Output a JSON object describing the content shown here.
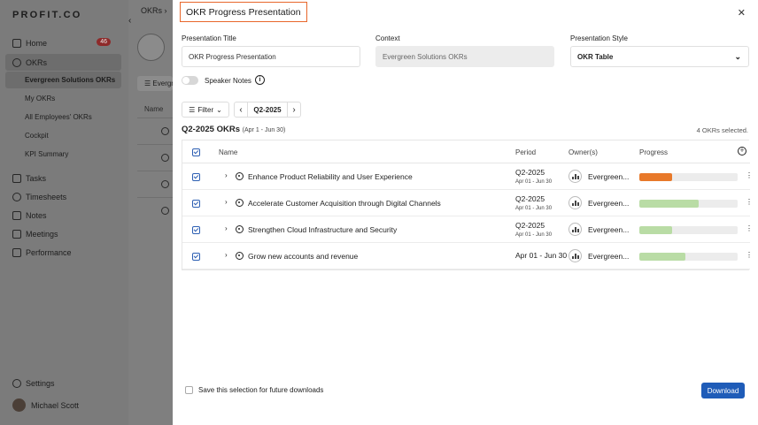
{
  "app": {
    "logo": "PROFIT.CO"
  },
  "sidebar": {
    "items": [
      {
        "label": "Home",
        "icon": "home-icon",
        "badge": "46"
      },
      {
        "label": "OKRs",
        "icon": "okr-icon"
      },
      {
        "label": "Evergreen Solutions OKRs"
      },
      {
        "label": "My OKRs"
      },
      {
        "label": "All Employees' OKRs"
      },
      {
        "label": "Cockpit"
      },
      {
        "label": "KPI Summary"
      },
      {
        "label": "Tasks",
        "icon": "tasks-icon"
      },
      {
        "label": "Timesheets",
        "icon": "timesheets-icon"
      },
      {
        "label": "Notes",
        "icon": "notes-icon"
      },
      {
        "label": "Meetings",
        "icon": "meetings-icon"
      },
      {
        "label": "Performance",
        "icon": "performance-icon"
      }
    ],
    "settings": "Settings",
    "user": "Michael Scott"
  },
  "background": {
    "breadcrumb": "OKRs",
    "pill": "Evergreen",
    "name_col": "Name"
  },
  "modal": {
    "title": "OKR Progress Presentation",
    "fields": {
      "title_label": "Presentation Title",
      "title_value": "OKR Progress Presentation",
      "context_label": "Context",
      "context_value": "Evergreen Solutions OKRs",
      "style_label": "Presentation Style",
      "style_value": "OKR Table"
    },
    "speaker_notes": "Speaker Notes",
    "filter": "Filter",
    "period": "Q2-2025",
    "section_title": "Q2-2025 OKRs",
    "section_range": "(Apr 1 - Jun 30)",
    "selected_count": "4 OKRs selected.",
    "columns": {
      "name": "Name",
      "period": "Period",
      "owner": "Owner(s)",
      "progress": "Progress"
    },
    "rows": [
      {
        "name": "Enhance Product Reliability and User Experience",
        "period": "Q2-2025",
        "range": "Apr 01 - Jun 30",
        "owner": "Evergreen...",
        "progress": 0.33,
        "color": "#e8792a"
      },
      {
        "name": "Accelerate Customer Acquisition through Digital Channels",
        "period": "Q2-2025",
        "range": "Apr 01 - Jun 30",
        "owner": "Evergreen...",
        "progress": 0.6,
        "color": "#b9dca5"
      },
      {
        "name": "Strengthen Cloud Infrastructure and Security",
        "period": "Q2-2025",
        "range": "Apr 01 - Jun 30",
        "owner": "Evergreen...",
        "progress": 0.33,
        "color": "#b9dca5"
      },
      {
        "name": "Grow new accounts and revenue",
        "period": "Apr 01 - Jun 30",
        "range": "",
        "owner": "Evergreen...",
        "progress": 0.47,
        "color": "#b9dca5"
      }
    ],
    "save_selection": "Save this selection for future downloads",
    "download": "Download"
  }
}
